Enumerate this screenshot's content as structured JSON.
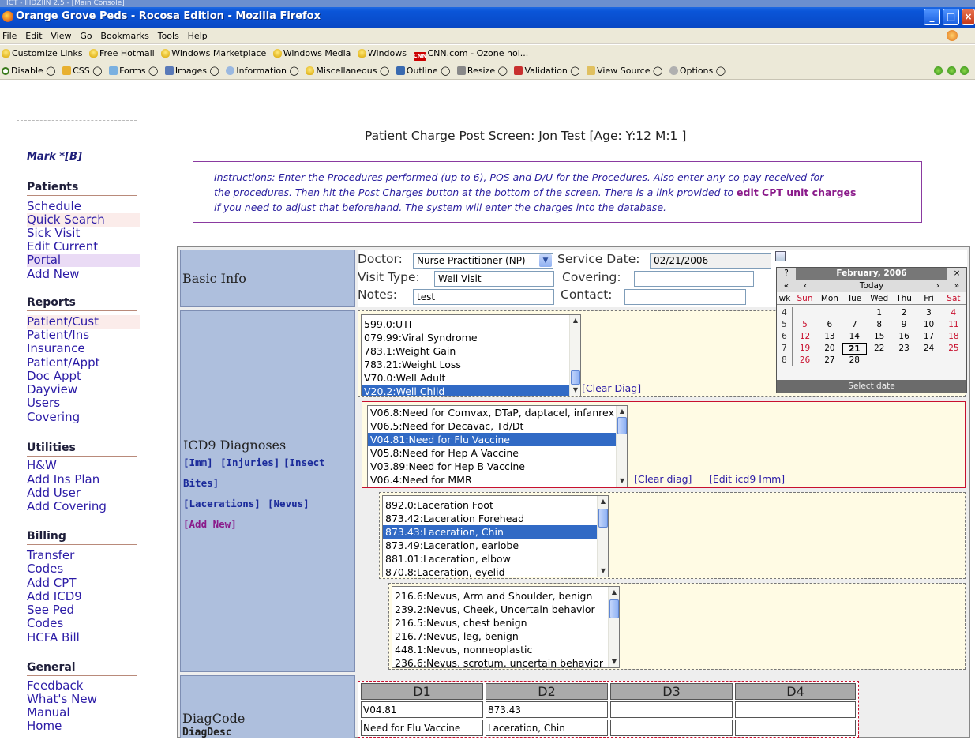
{
  "window": {
    "strip_text": "ICT - IIIDZIIN 2.5 - [Main Console]",
    "title": "Orange Grove Peds - Rocosa Edition - Mozilla Firefox"
  },
  "menu": [
    "File",
    "Edit",
    "View",
    "Go",
    "Bookmarks",
    "Tools",
    "Help"
  ],
  "links_bar": [
    "Customize Links",
    "Free Hotmail",
    "Windows Marketplace",
    "Windows Media",
    "Windows",
    "CNN.com - Ozone hol..."
  ],
  "devbar": [
    "Disable",
    "CSS",
    "Forms",
    "Images",
    "Information",
    "Miscellaneous",
    "Outline",
    "Resize",
    "Validation",
    "View Source",
    "Options"
  ],
  "nav": {
    "user": "Mark *[B]",
    "sections": [
      {
        "title": "Patients",
        "items": [
          "Schedule",
          "Quick Search",
          "Sick Visit",
          "Edit Current",
          "Portal",
          "Add New"
        ]
      },
      {
        "title": "Reports",
        "items": [
          "Patient/Cust",
          "Patient/Ins",
          "Insurance",
          "Patient/Appt",
          "Doc Appt",
          "Dayview",
          "Users",
          "Covering"
        ]
      },
      {
        "title": "Utilities",
        "items": [
          "H&W",
          "Add Ins Plan",
          "Add User",
          "Add Covering"
        ]
      },
      {
        "title": "Billing",
        "items": [
          "Transfer",
          "Codes",
          "Add CPT",
          "Add ICD9",
          "See Ped",
          "Codes",
          "HCFA Bill"
        ]
      },
      {
        "title": "General",
        "items": [
          "Feedback",
          "What's New",
          "Manual",
          "Home"
        ]
      }
    ]
  },
  "heading": "Patient Charge Post Screen: Jon Test [Age: Y:12 M:1 ]",
  "instructions": {
    "line1": "Instructions: Enter the Procedures performed (up to 6), POS and D/U for the Procedures. Also enter any co-pay received for",
    "line2_pre": "the procedures. Then hit the Post Charges button at the bottom of the screen. There is a link provided to ",
    "line2_link": "edit CPT unit charges",
    "line3": "if you need to adjust that beforehand. The system will enter the charges into the database."
  },
  "basic_info": {
    "label": "Basic Info",
    "doctor_label": "Doctor:",
    "doctor_value": "Nurse Practitioner (NP)",
    "service_date_label": "Service Date:",
    "service_date_value": "02/21/2006",
    "visit_type_label": "Visit Type:",
    "visit_type_value": "Well Visit",
    "covering_label": "Covering:",
    "covering_value": "",
    "notes_label": "Notes:",
    "notes_value": "test",
    "contact_label": "Contact:",
    "contact_value": ""
  },
  "calendar": {
    "help": "?",
    "close": "×",
    "month_title": "February, 2006",
    "prev_year": "«",
    "prev_month": "‹",
    "today": "Today",
    "next_month": "›",
    "next_year": "»",
    "weekday_headers": [
      "wk",
      "Sun",
      "Mon",
      "Tue",
      "Wed",
      "Thu",
      "Fri",
      "Sat"
    ],
    "weeks": [
      [
        "4",
        "",
        "",
        "",
        "1",
        "2",
        "3",
        "4"
      ],
      [
        "5",
        "5",
        "6",
        "7",
        "8",
        "9",
        "10",
        "11"
      ],
      [
        "6",
        "12",
        "13",
        "14",
        "15",
        "16",
        "17",
        "18"
      ],
      [
        "7",
        "19",
        "20",
        "21",
        "22",
        "23",
        "24",
        "25"
      ],
      [
        "8",
        "26",
        "27",
        "28",
        "",
        "",
        "",
        ""
      ]
    ],
    "selected_day": "21",
    "footer": "Select date"
  },
  "icd9": {
    "label": "ICD9 Diagnoses",
    "links": {
      "imm": "[Imm]",
      "injuries": "[Injuries]",
      "insect": "[Insect",
      "bites": "Bites]",
      "lacerations": "[Lacerations]",
      "nevus": "[Nevus]",
      "add_new": "[Add New]"
    },
    "list1": {
      "options": [
        "599.0:UTI",
        "079.99:Viral Syndrome",
        "783.1:Weight Gain",
        "783.21:Weight Loss",
        "V70.0:Well Adult",
        "V20.2:Well Child"
      ],
      "selected": "V20.2:Well Child",
      "clear": "[Clear Diag]"
    },
    "list2": {
      "options": [
        "V06.8:Need for Comvax, DTaP, daptacel, infanrex",
        "V06.5:Need for Decavac, Td/Dt",
        "V04.81:Need for Flu Vaccine",
        "V05.8:Need for Hep A Vaccine",
        "V03.89:Need for Hep B Vaccine",
        "V06.4:Need for MMR"
      ],
      "selected": "V04.81:Need for Flu Vaccine",
      "clear": "[Clear diag]",
      "edit": "[Edit icd9 Imm]"
    },
    "list3": {
      "options": [
        "892.0:Laceration Foot",
        "873.42:Laceration Forehead",
        "873.43:Laceration, Chin",
        "873.49:Laceration, earlobe",
        "881.01:Laceration, elbow",
        "870.8:Laceration, eyelid"
      ],
      "selected": "873.43:Laceration, Chin"
    },
    "list4": {
      "options": [
        "216.6:Nevus, Arm and Shoulder, benign",
        "239.2:Nevus, Cheek, Uncertain behavior",
        "216.5:Nevus, chest benign",
        "216.7:Nevus, leg, benign",
        "448.1:Nevus, nonneoplastic",
        "236.6:Nevus, scrotum, uncertain behavior"
      ]
    }
  },
  "diag": {
    "label_code": "DiagCode",
    "label_desc": "DiagDesc",
    "headers": [
      "D1",
      "D2",
      "D3",
      "D4"
    ],
    "codes": [
      "V04.81",
      "873.43",
      "",
      ""
    ],
    "descs": [
      "Need for Flu Vaccine",
      "Laceration, Chin",
      "",
      ""
    ]
  }
}
